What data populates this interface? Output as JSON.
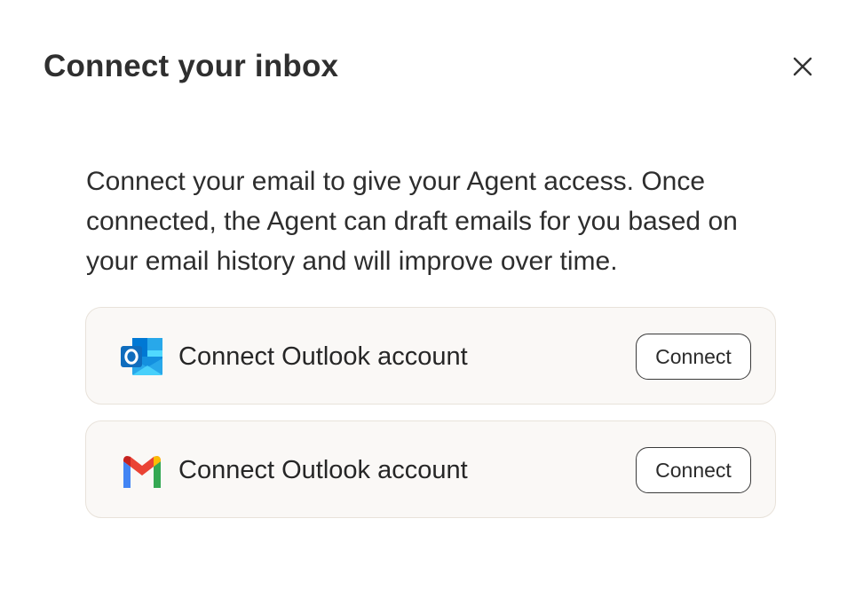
{
  "modal": {
    "title": "Connect your inbox",
    "close_icon": "close-icon",
    "description": "Connect your email to give your Agent access. Once connected, the Agent can draft emails for you based on your email history and will improve over time."
  },
  "accounts": [
    {
      "provider_icon": "outlook-icon",
      "label": "Connect Outlook account",
      "button_label": "Connect"
    },
    {
      "provider_icon": "gmail-icon",
      "label": "Connect Outlook account",
      "button_label": "Connect"
    }
  ],
  "colors": {
    "card_background": "#faf8f6",
    "card_border": "#e8e2da",
    "outlook_blue": "#0f6cbd",
    "gmail_red": "#ea4335",
    "gmail_blue": "#4285f4",
    "gmail_green": "#34a853",
    "gmail_yellow": "#fbbc04"
  }
}
